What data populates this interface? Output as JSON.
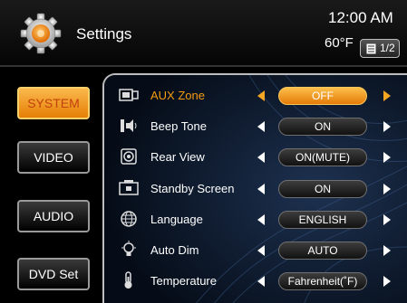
{
  "header": {
    "title": "Settings",
    "time": "12:00 AM",
    "temperature": "60°F",
    "page": "1/2"
  },
  "nav": [
    {
      "label": "SYSTEM",
      "active": true
    },
    {
      "label": "VIDEO",
      "active": false
    },
    {
      "label": "AUDIO",
      "active": false
    },
    {
      "label": "DVD Set",
      "active": false
    }
  ],
  "settings": [
    {
      "label": "AUX Zone",
      "value": "OFF",
      "icon": "aux-zone-icon",
      "selected": true
    },
    {
      "label": "Beep Tone",
      "value": "ON",
      "icon": "beep-tone-icon",
      "selected": false
    },
    {
      "label": "Rear View",
      "value": "ON(MUTE)",
      "icon": "rear-view-icon",
      "selected": false
    },
    {
      "label": "Standby Screen",
      "value": "ON",
      "icon": "standby-screen-icon",
      "selected": false
    },
    {
      "label": "Language",
      "value": "ENGLISH",
      "icon": "language-icon",
      "selected": false
    },
    {
      "label": "Auto Dim",
      "value": "AUTO",
      "icon": "auto-dim-icon",
      "selected": false
    },
    {
      "label": "Temperature",
      "value": "Fahrenheit(˚F)",
      "icon": "temperature-icon",
      "selected": false
    }
  ],
  "colors": {
    "accent": "#f39c12",
    "selected_fill": "#fbb84c",
    "background": "#000000",
    "panel_background": "#07111f"
  }
}
